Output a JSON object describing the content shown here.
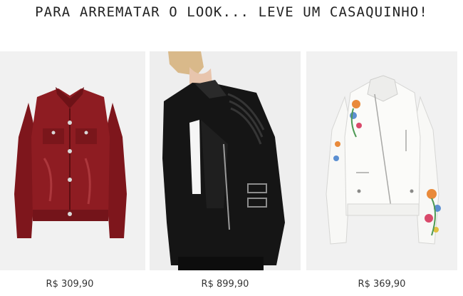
{
  "section": {
    "title": "PARA ARREMATAR O LOOK... LEVE UM CASAQUINHO!"
  },
  "products": [
    {
      "price": "R$ 309,90",
      "color": "#8e1c22",
      "image": "red-leather-jacket-image"
    },
    {
      "price": "R$ 899,90",
      "color": "#161616",
      "image": "black-biker-jacket-image"
    },
    {
      "price": "R$ 369,90",
      "color": "#f4f4f2",
      "image": "white-embroidered-jacket-image"
    }
  ]
}
